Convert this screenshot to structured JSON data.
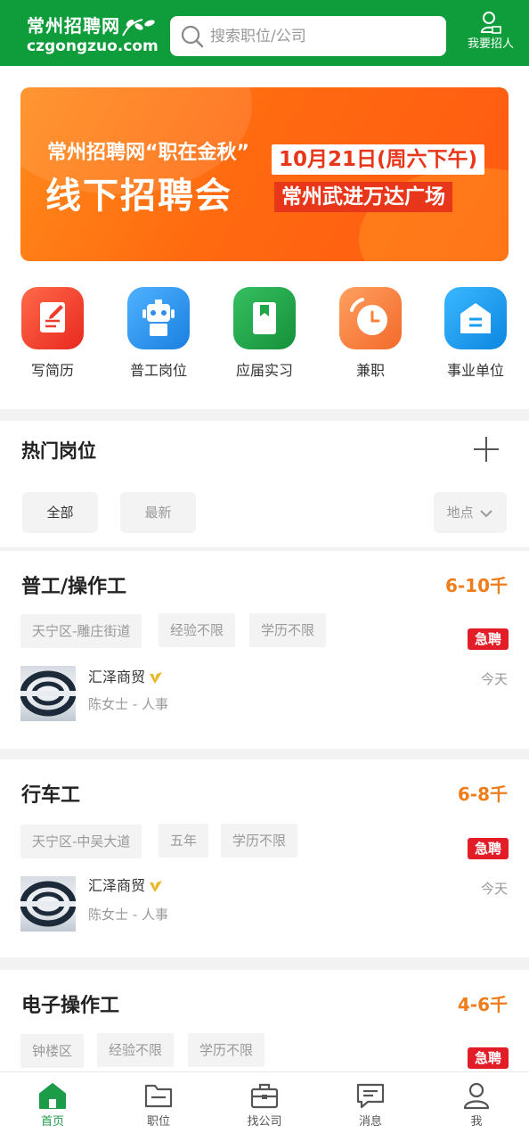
{
  "header": {
    "logo_cn": "常州招聘网",
    "logo_en": "czgongzuo.com",
    "search_placeholder": "搜索职位/公司",
    "recruit_label": "我要招人"
  },
  "banner": {
    "line1": "常州招聘网“职在金秋”",
    "line2": "线下招聘会",
    "date": "10月21日(周六下午)",
    "venue": "常州武进万达广场"
  },
  "categories": [
    {
      "label": "写简历",
      "icon": "resume-icon",
      "color": "#ef3b2c"
    },
    {
      "label": "普工岗位",
      "icon": "robot-icon",
      "color": "#2f8fe8"
    },
    {
      "label": "应届实习",
      "icon": "book-icon",
      "color": "#22a64a"
    },
    {
      "label": "兼职",
      "icon": "clock-icon",
      "color": "#f7833a"
    },
    {
      "label": "事业单位",
      "icon": "building-icon",
      "color": "#1a9cf0"
    }
  ],
  "hot": {
    "title": "热门岗位",
    "filters": [
      "全部",
      "最新"
    ],
    "location": "地点"
  },
  "jobs": [
    {
      "title": "普工/操作工",
      "salary": "6-10千",
      "tags": [
        "天宁区-雕庄街道",
        "经验不限",
        "学历不限"
      ],
      "urgent": "急聘",
      "company": "汇泽商贸",
      "contact": "陈女士 - 人事",
      "posted": "今天"
    },
    {
      "title": "行车工",
      "salary": "6-8千",
      "tags": [
        "天宁区-中吴大道",
        "五年",
        "学历不限"
      ],
      "urgent": "急聘",
      "company": "汇泽商贸",
      "contact": "陈女士 - 人事",
      "posted": "今天"
    },
    {
      "title": "电子操作工",
      "salary": "4-6千",
      "tags": [
        "钟楼区",
        "经验不限",
        "学历不限"
      ],
      "urgent": "急聘"
    }
  ],
  "nav": [
    {
      "label": "首页",
      "icon": "home-icon"
    },
    {
      "label": "职位",
      "icon": "folder-icon"
    },
    {
      "label": "找公司",
      "icon": "briefcase-icon"
    },
    {
      "label": "消息",
      "icon": "message-icon"
    },
    {
      "label": "我",
      "icon": "user-icon"
    }
  ],
  "colors": {
    "brand_green": "#0f9d3b",
    "salary_orange": "#f07d1b",
    "urgent_red": "#e21d27"
  }
}
